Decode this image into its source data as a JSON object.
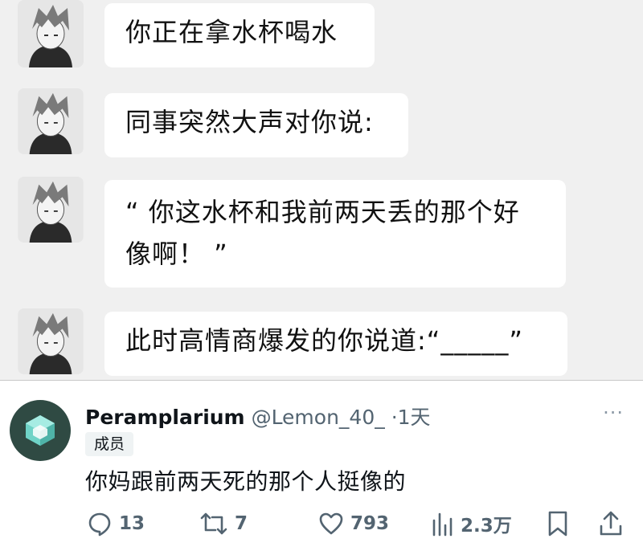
{
  "chat": {
    "messages": [
      {
        "text": "你正在拿水杯喝水"
      },
      {
        "text": "同事突然大声对你说:"
      },
      {
        "line1": "“ 你这水杯和我前两天丢的那个好",
        "line2": "像啊！ ”"
      },
      {
        "text": "此时高情商爆发的你说道:“_____”"
      }
    ]
  },
  "tweet": {
    "display_name": "Peramplarium",
    "handle": "@Lemon_40_",
    "dot": "·",
    "time": "1天",
    "badge": "成员",
    "text": "你妈跟前两天死的那个人挺像的",
    "avatar_color": "#2f4a43",
    "accent_color": "#6fd3c7",
    "more_icon": "···"
  },
  "actions": {
    "reply_count": "13",
    "retweet_count": "7",
    "like_count": "793",
    "views_count": "2.3万"
  },
  "icons": [
    "reply-icon",
    "retweet-icon",
    "like-icon",
    "views-icon",
    "bookmark-icon",
    "share-icon",
    "more-icon"
  ]
}
